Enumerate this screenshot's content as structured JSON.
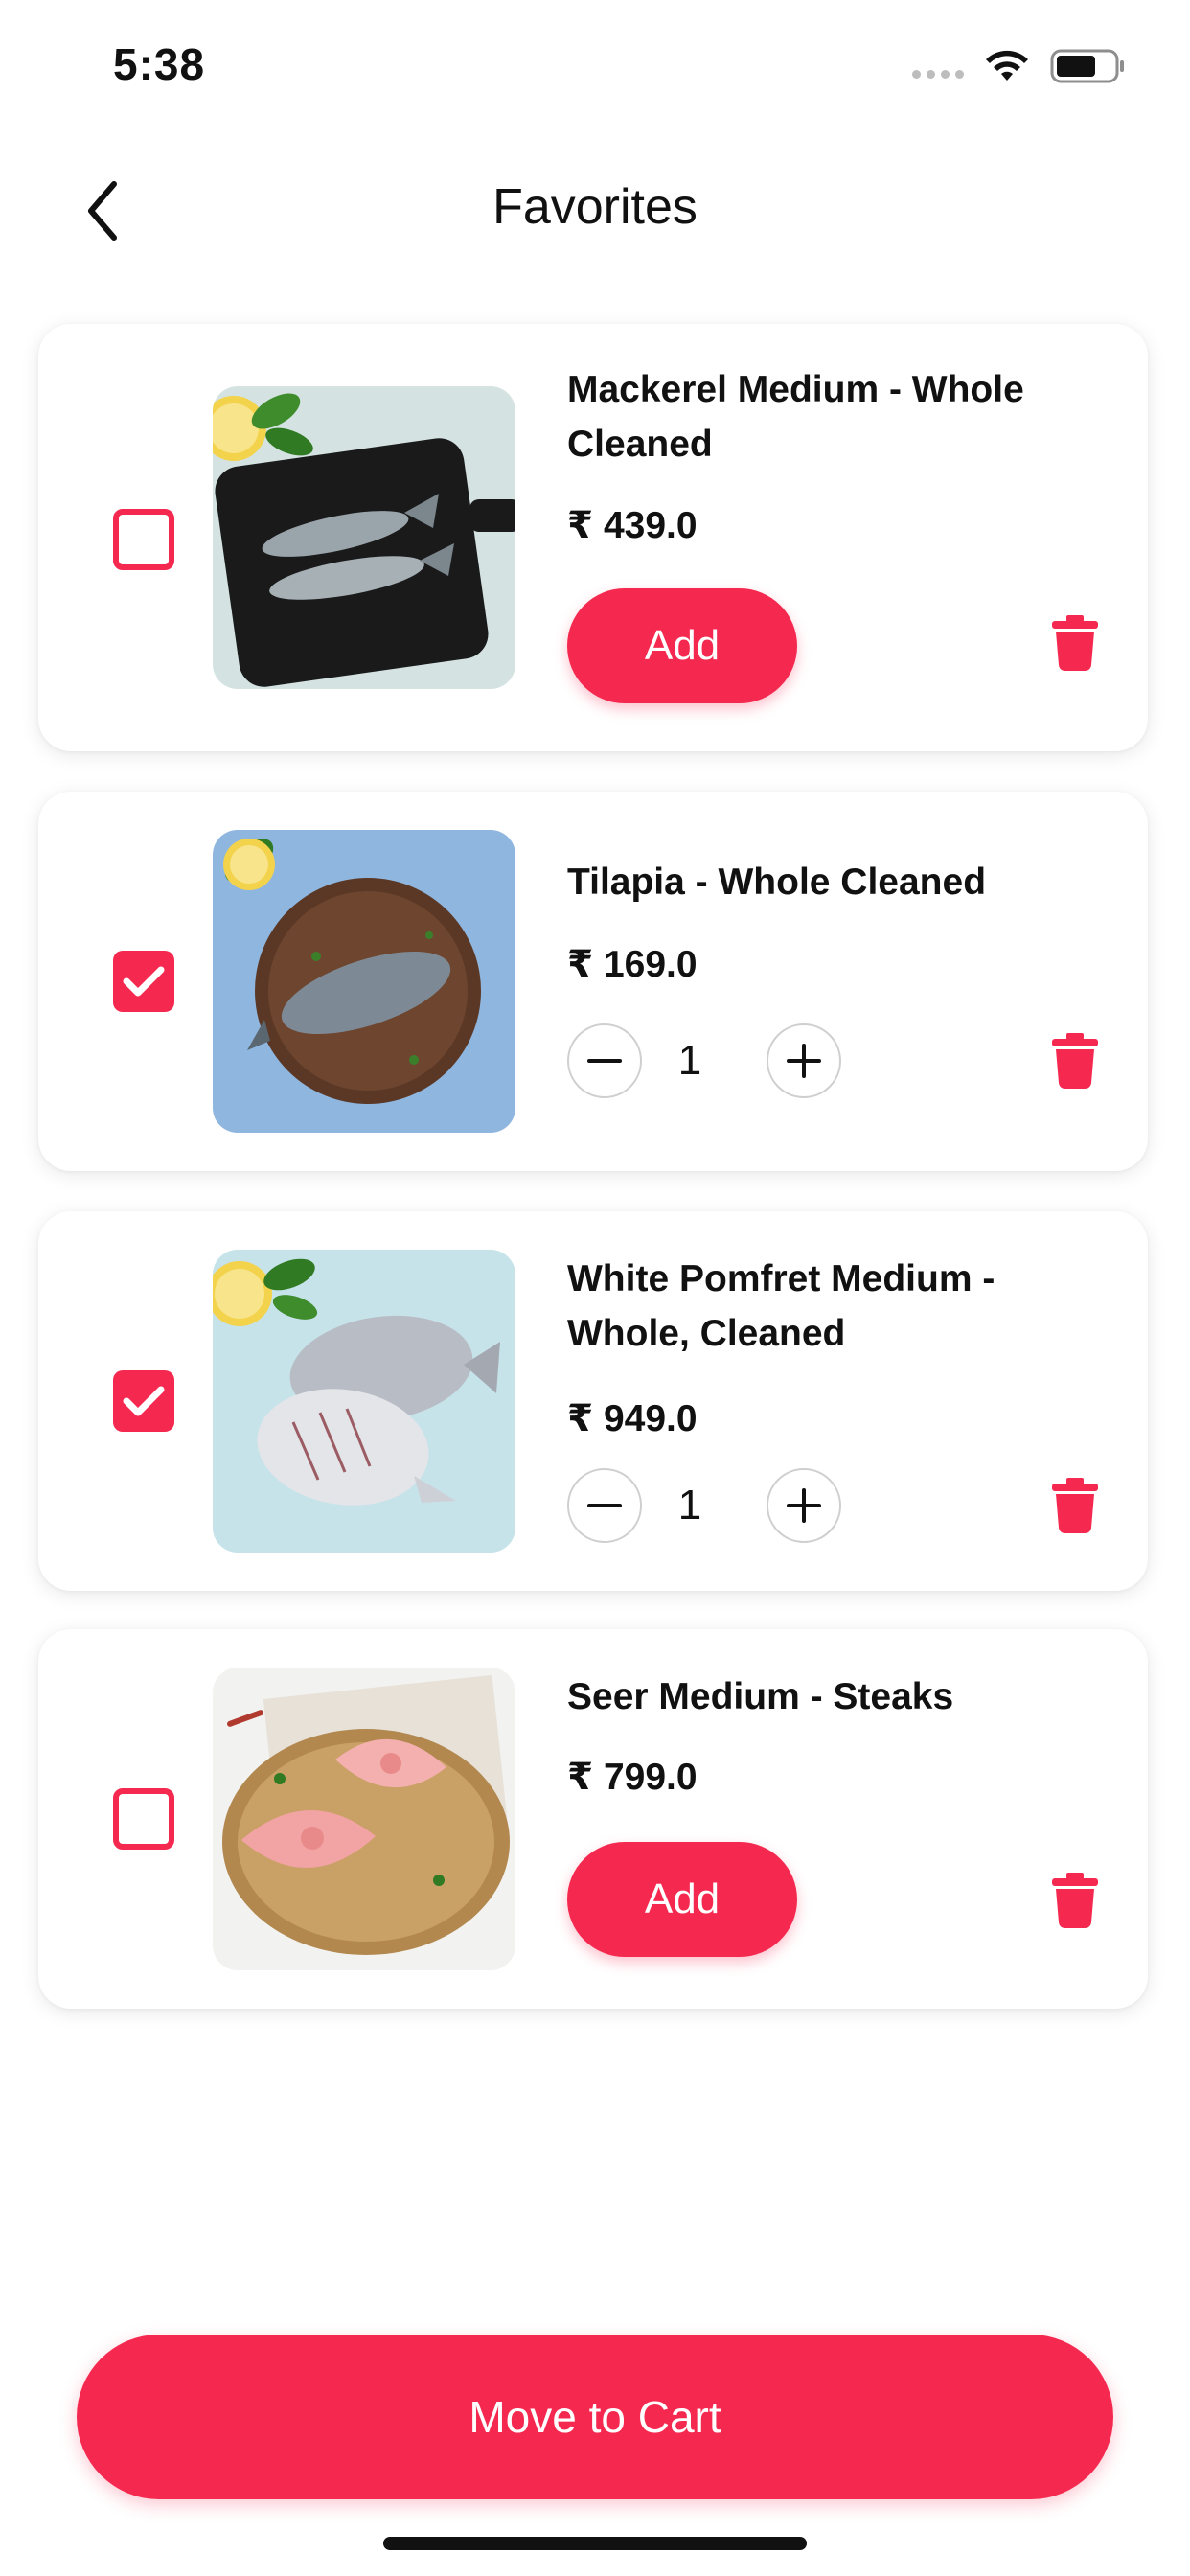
{
  "status_bar": {
    "time": "5:38"
  },
  "header": {
    "title": "Favorites"
  },
  "items": [
    {
      "name": "Mackerel Medium - Whole Cleaned",
      "price": "₹ 439.0",
      "selected": false,
      "add_label": "Add",
      "image": "mackerel-on-black-board"
    },
    {
      "name": "Tilapia  - Whole Cleaned",
      "price": "₹ 169.0",
      "selected": true,
      "quantity": "1",
      "image": "tilapia-on-wooden-plate"
    },
    {
      "name": "White Pomfret Medium - Whole, Cleaned",
      "price": "₹ 949.0",
      "selected": true,
      "quantity": "1",
      "image": "white-pomfret-on-blue"
    },
    {
      "name": "Seer Medium - Steaks",
      "price": "₹ 799.0",
      "selected": false,
      "add_label": "Add",
      "image": "seer-steaks-on-wooden-plate"
    }
  ],
  "footer": {
    "move_to_cart_label": "Move to Cart"
  },
  "colors": {
    "accent": "#f5294f",
    "text": "#111111",
    "card_bg": "#ffffff"
  }
}
